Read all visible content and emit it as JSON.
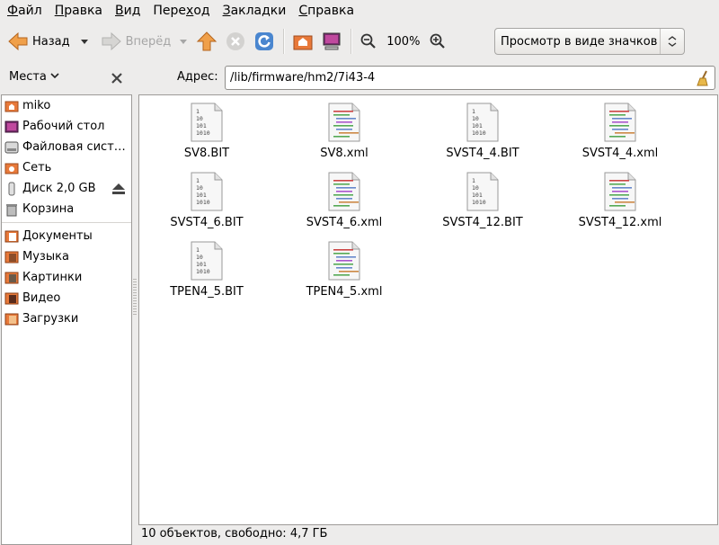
{
  "menubar": {
    "items": [
      {
        "first": "Ф",
        "rest": "айл"
      },
      {
        "first": "П",
        "rest": "равка"
      },
      {
        "first": "В",
        "rest": "ид"
      },
      {
        "first": "Пере",
        "u": "х",
        "rest": "од"
      },
      {
        "first": "З",
        "rest": "акладки"
      },
      {
        "first": "С",
        "rest": "правка"
      }
    ]
  },
  "toolbar": {
    "back_label": "Назад",
    "forward_label": "Вперёд",
    "zoom_level": "100%",
    "view_mode": "Просмотр в виде значков"
  },
  "places": {
    "title": "Места",
    "items": [
      {
        "label": "miko",
        "icon": "home-folder-icon"
      },
      {
        "label": "Рабочий стол",
        "icon": "desktop-icon"
      },
      {
        "label": "Файловая сист…",
        "icon": "filesystem-icon"
      },
      {
        "label": "Сеть",
        "icon": "network-icon"
      },
      {
        "label": "Диск 2,0 GB",
        "icon": "usb-drive-icon"
      },
      {
        "label": "Корзина",
        "icon": "trash-icon"
      }
    ],
    "bookmarks": [
      {
        "label": "Документы",
        "icon": "folder-icon"
      },
      {
        "label": "Музыка",
        "icon": "folder-icon"
      },
      {
        "label": "Картинки",
        "icon": "folder-icon"
      },
      {
        "label": "Видео",
        "icon": "folder-icon"
      },
      {
        "label": "Загрузки",
        "icon": "folder-icon"
      }
    ]
  },
  "address": {
    "label": "Адрес:",
    "value": "/lib/firmware/hm2/7i43-4"
  },
  "files": [
    {
      "name": "SV8.BIT",
      "type": "binary"
    },
    {
      "name": "SV8.xml",
      "type": "xml"
    },
    {
      "name": "SVST4_4.BIT",
      "type": "binary"
    },
    {
      "name": "SVST4_4.xml",
      "type": "xml"
    },
    {
      "name": "SVST4_6.BIT",
      "type": "binary"
    },
    {
      "name": "SVST4_6.xml",
      "type": "xml"
    },
    {
      "name": "SVST4_12.BIT",
      "type": "binary"
    },
    {
      "name": "SVST4_12.xml",
      "type": "xml"
    },
    {
      "name": "TPEN4_5.BIT",
      "type": "binary"
    },
    {
      "name": "TPEN4_5.xml",
      "type": "xml"
    }
  ],
  "binary_icon_lines": [
    "1",
    "10",
    "101",
    "1010"
  ],
  "status": "10 объектов, свободно: 4,7 ГБ"
}
